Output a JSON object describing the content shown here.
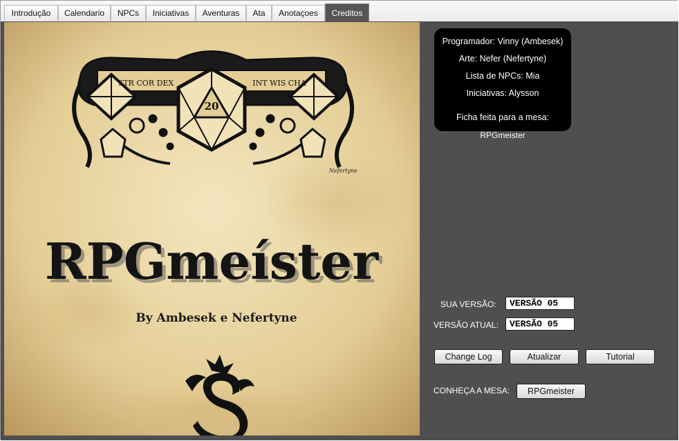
{
  "tabs": [
    {
      "label": "Introdução"
    },
    {
      "label": "Calendario"
    },
    {
      "label": "NPCs"
    },
    {
      "label": "Iniciativas"
    },
    {
      "label": "Aventuras"
    },
    {
      "label": "Ata"
    },
    {
      "label": "Anotaçoes"
    },
    {
      "label": "Creditos"
    }
  ],
  "active_tab": "Creditos",
  "poster": {
    "title": "RPGmeíster",
    "subtitle": "By Ambesek e Nefertyne",
    "dice_text_left": "STR COR DEX",
    "dice_text_right": "INT WIS CHA",
    "d20_face": "20",
    "artist_signature": "Nefertyne"
  },
  "credits": {
    "programmer": "Programador: Vinny (Ambesek)",
    "art": "Arte: Nefer (Nefertyne)",
    "npc_list": "Lista de NPCs: Mia",
    "initiatives": "Iniciativas: Alysson",
    "made_for": "Ficha feita para a mesa:",
    "table_name": "RPGmeister"
  },
  "version": {
    "yours_label": "SUA VERSÃO:",
    "yours_value": "VERSÃO 05",
    "current_label": "VERSÃO ATUAL:",
    "current_value": "VERSÃO 05"
  },
  "buttons": {
    "changelog": "Change Log",
    "update": "Atualizar",
    "tutorial": "Tutorial",
    "meet_label": "CONHEÇA A MESA:",
    "meet_button": "RPGmeister"
  },
  "colors": {
    "panel_bg": "#4f4f4f",
    "poster_paper": "#e6d3a0",
    "ink": "#111111"
  }
}
